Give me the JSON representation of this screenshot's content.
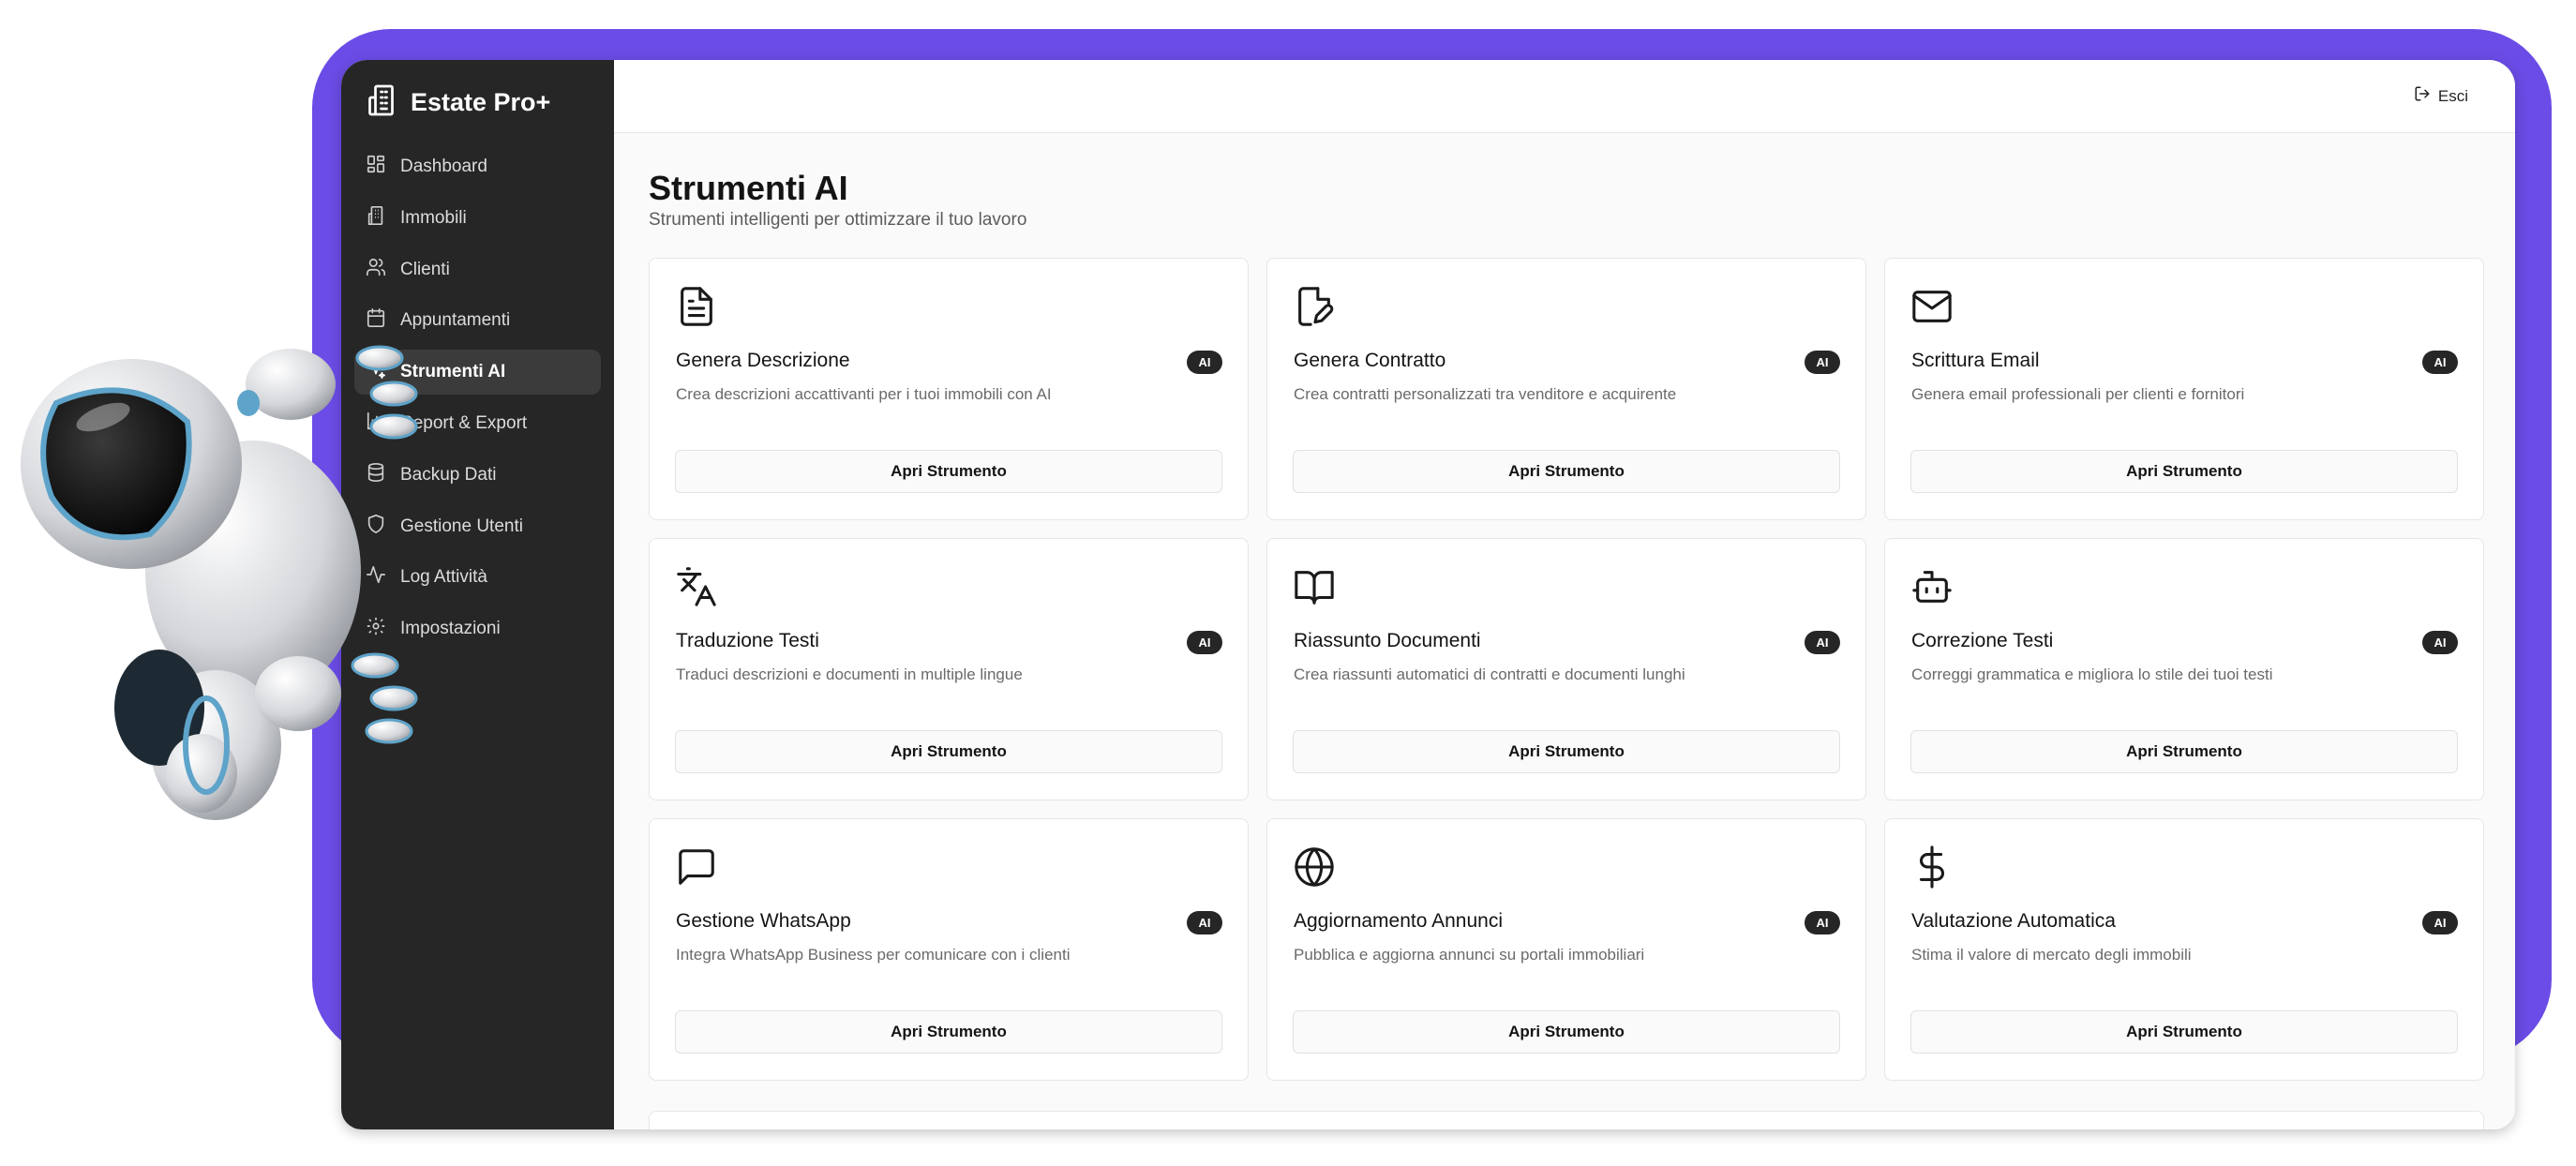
{
  "app": {
    "name": "Estate Pro+"
  },
  "header": {
    "logout_label": "Esci"
  },
  "sidebar": {
    "items": [
      {
        "label": "Dashboard",
        "icon": "dashboard-icon"
      },
      {
        "label": "Immobili",
        "icon": "building-icon"
      },
      {
        "label": "Clienti",
        "icon": "users-icon"
      },
      {
        "label": "Appuntamenti",
        "icon": "calendar-icon"
      },
      {
        "label": "Strumenti AI",
        "icon": "sparkles-icon",
        "active": true
      },
      {
        "label": "Report & Export",
        "icon": "bar-chart-icon"
      },
      {
        "label": "Backup Dati",
        "icon": "database-icon"
      },
      {
        "label": "Gestione Utenti",
        "icon": "shield-icon"
      },
      {
        "label": "Log Attività",
        "icon": "activity-icon"
      },
      {
        "label": "Impostazioni",
        "icon": "gear-icon"
      }
    ]
  },
  "main": {
    "title": "Strumenti AI",
    "subtitle": "Strumenti intelligenti per ottimizzare il tuo lavoro",
    "badge_label": "AI",
    "button_label": "Apri Strumento",
    "tools": [
      {
        "title": "Genera Descrizione",
        "description": "Crea descrizioni accattivanti per i tuoi immobili con AI",
        "icon": "document-icon"
      },
      {
        "title": "Genera Contratto",
        "description": "Crea contratti personalizzati tra venditore e acquirente",
        "icon": "file-signature-icon"
      },
      {
        "title": "Scrittura Email",
        "description": "Genera email professionali per clienti e fornitori",
        "icon": "mail-icon"
      },
      {
        "title": "Traduzione Testi",
        "description": "Traduci descrizioni e documenti in multiple lingue",
        "icon": "translate-icon"
      },
      {
        "title": "Riassunto Documenti",
        "description": "Crea riassunti automatici di contratti e documenti lunghi",
        "icon": "book-icon"
      },
      {
        "title": "Correzione Testi",
        "description": "Correggi grammatica e migliora lo stile dei tuoi testi",
        "icon": "robot-icon"
      },
      {
        "title": "Gestione WhatsApp",
        "description": "Integra WhatsApp Business per comunicare con i clienti",
        "icon": "chat-bubble-icon"
      },
      {
        "title": "Aggiornamento Annunci",
        "description": "Pubblica e aggiorna annunci su portali immobiliari",
        "icon": "globe-icon"
      },
      {
        "title": "Valutazione Automatica",
        "description": "Stima il valore di mercato degli immobili",
        "icon": "dollar-icon"
      }
    ]
  },
  "colors": {
    "frame": "#6b4ce6",
    "sidebar": "#262626",
    "badge": "#262626"
  }
}
